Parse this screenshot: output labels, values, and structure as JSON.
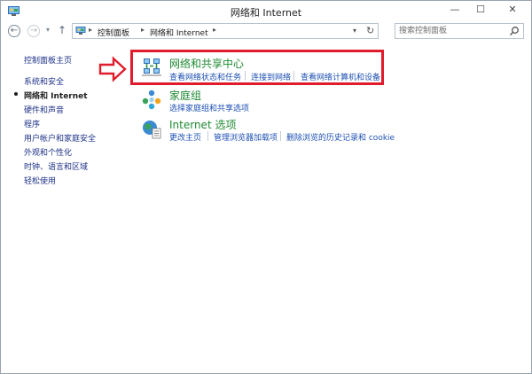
{
  "window": {
    "title": "网络和 Internet",
    "minimize_label": "—",
    "maximize_label": "☐",
    "close_label": "✕"
  },
  "nav": {
    "back_glyph": "←",
    "forward_glyph": "→",
    "recent_glyph": "▾",
    "up_glyph": "↑",
    "breadcrumb": [
      "控制面板",
      "网络和 Internet"
    ],
    "crumb_separator": "▸",
    "dropdown_glyph": "▾",
    "refresh_glyph": "↻",
    "search_placeholder": "搜索控制面板"
  },
  "sidebar": {
    "home_label": "控制面板主页",
    "items": [
      {
        "label": "系统和安全",
        "current": false
      },
      {
        "label": "网络和 Internet",
        "current": true
      },
      {
        "label": "硬件和声音",
        "current": false
      },
      {
        "label": "程序",
        "current": false
      },
      {
        "label": "用户帐户和家庭安全",
        "current": false
      },
      {
        "label": "外观和个性化",
        "current": false
      },
      {
        "label": "时钟、语言和区域",
        "current": false
      },
      {
        "label": "轻松使用",
        "current": false
      }
    ]
  },
  "categories": [
    {
      "icon": "network-sharing-center-icon",
      "title": "网络和共享中心",
      "links": [
        "查看网络状态和任务",
        "连接到网络",
        "查看网络计算机和设备"
      ]
    },
    {
      "icon": "homegroup-icon",
      "title": "家庭组",
      "links": [
        "选择家庭组和共享选项"
      ]
    },
    {
      "icon": "internet-options-icon",
      "title": "Internet 选项",
      "links": [
        "更改主页",
        "管理浏览器加载项",
        "删除浏览的历史记录和 cookie"
      ]
    }
  ],
  "colors": {
    "category_title": "#1e8a32",
    "link": "#1e50b4",
    "annotation_red": "#e01c2c"
  }
}
